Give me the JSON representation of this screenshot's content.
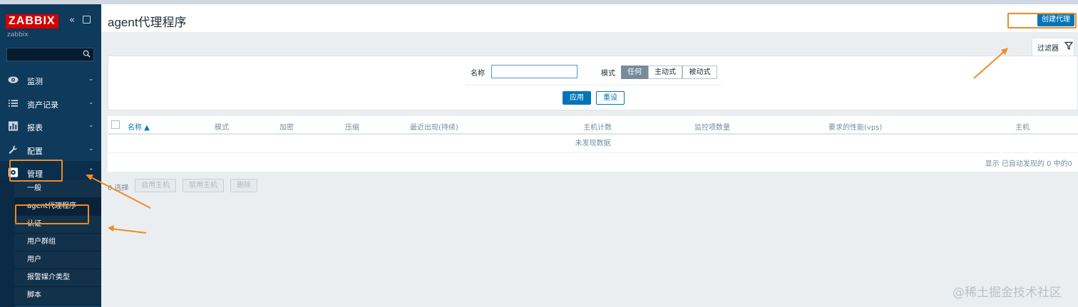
{
  "sidebar": {
    "logo": "ZABBIX",
    "server_name": "zabbix",
    "search": {
      "value": "",
      "placeholder": ""
    },
    "menu": [
      {
        "label": "监测",
        "icon": "eye-icon"
      },
      {
        "label": "资产记录",
        "icon": "list-icon"
      },
      {
        "label": "报表",
        "icon": "bar-chart-icon"
      },
      {
        "label": "配置",
        "icon": "wrench-icon"
      },
      {
        "label": "管理",
        "icon": "gear-icon"
      }
    ],
    "submenu": [
      "一般",
      "agent代理程序",
      "认证",
      "用户群组",
      "用户",
      "报警媒介类型",
      "脚本"
    ]
  },
  "header": {
    "title": "agent代理程序",
    "create_button": "创建代理"
  },
  "filter": {
    "tab_label": "过滤器",
    "name_label": "名称",
    "name_value": "",
    "mode_label": "模式",
    "mode_options": [
      "任何",
      "主动式",
      "被动式"
    ],
    "mode_selected": "任何",
    "apply_label": "应用",
    "reset_label": "重设"
  },
  "table": {
    "columns": [
      "名称 ▲",
      "模式",
      "加密",
      "压缩",
      "最近出现(持续)",
      "主机计数",
      "监控项数量",
      "要求的性能(vps)",
      "主机"
    ],
    "sort_column": "名称",
    "empty_text": "未发现数据",
    "summary": "显示 已自动发现的 0 中的0"
  },
  "footer": {
    "selected": "0 选择",
    "enable_hosts": "启用主机",
    "disable_hosts": "禁用主机",
    "delete": "删除"
  },
  "watermark": "@稀土掘金技术社区",
  "colors": {
    "sidebar_bg": "#0e3a5c",
    "brand_red": "#d40000",
    "primary_blue": "#0275b8",
    "annotation_orange": "#f08a24"
  }
}
